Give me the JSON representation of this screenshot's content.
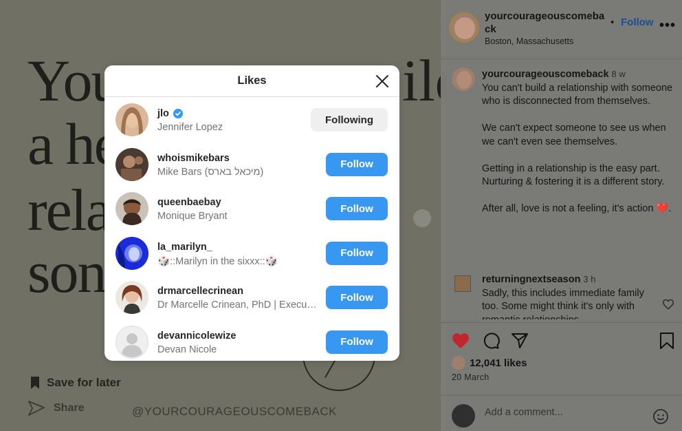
{
  "background_post": {
    "big_text_lines": [
      "You",
      "a he",
      "rela",
      "son"
    ],
    "big_text_right": [
      "ild"
    ],
    "next_arrow_glyph": "›",
    "save_later_label": "Save for later",
    "share_label": "Share",
    "handle_caption": "@YOURCOURAGEOUSCOMEBACK"
  },
  "sidebar": {
    "header": {
      "username": "yourcourageouscomeba ck",
      "location": "Boston, Massachusetts",
      "dot": "•",
      "follow_label": "Follow",
      "more_label": "•••"
    },
    "caption": {
      "username": "yourcourageouscomeback",
      "time": "8 w",
      "paragraphs": [
        "You can't build a relationship with someone who is disconnected from themselves.",
        "We can't expect someone to see us when we can't even see themselves.",
        "Getting in a relationship is the easy part. Nurturing & fostering it is a different story.",
        "After all, love is not a feeling, it's action ❤️."
      ]
    },
    "comment": {
      "username": "returningnextseason",
      "time": "3 h",
      "text": "Sadly, this includes immediate family too. Some might think it's only with romantic relationships"
    },
    "likes_label": "12,041 likes",
    "date": "20 March",
    "add_comment_placeholder": "Add a comment..."
  },
  "likes_modal": {
    "title": "Likes",
    "users": [
      {
        "username": "jlo",
        "full_name": "Jennifer Lopez",
        "verified": true,
        "button": "Following"
      },
      {
        "username": "whoismikebars",
        "full_name": "Mike Bars (מיכאל בארס)",
        "verified": false,
        "button": "Follow"
      },
      {
        "username": "queenbaebay",
        "full_name": "Monique Bryant",
        "verified": false,
        "button": "Follow"
      },
      {
        "username": "la_marilyn_",
        "full_name": "🎲::Marilyn in the sixxx::🎲",
        "verified": false,
        "button": "Follow"
      },
      {
        "username": "drmarcellecrinean",
        "full_name": "Dr Marcelle Crinean, PhD | Executive Coach",
        "verified": false,
        "button": "Follow"
      },
      {
        "username": "devannicolewize",
        "full_name": "Devan Nicole",
        "verified": false,
        "button": "Follow"
      }
    ]
  },
  "colors": {
    "follow_blue": "#3897f0",
    "like_red": "#c1252f",
    "verified_blue": "#3897f0"
  }
}
